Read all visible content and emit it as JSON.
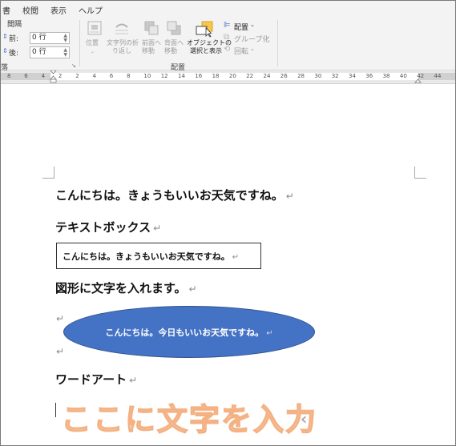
{
  "ribbon": {
    "tabs": [
      "書",
      "校閲",
      "表示",
      "ヘルプ"
    ],
    "spacing_label": "間隔",
    "before_label": "前:",
    "before_value": "0 行",
    "after_label": "後:",
    "after_value": "0 行",
    "paragraph_group_label": "落",
    "position_label": "位置",
    "wrap_text_label_1": "文字列の折",
    "wrap_text_label_2": "り返し",
    "bring_forward_label_1": "前面へ",
    "bring_forward_label_2": "移動",
    "send_backward_label_1": "背面へ",
    "send_backward_label_2": "移動",
    "selection_pane_label_1": "オブジェクトの",
    "selection_pane_label_2": "選択と表示",
    "align_label": "配置",
    "group_label": "グループ化",
    "rotate_label": "回転",
    "arrange_group_label": "配置"
  },
  "ruler": {
    "numbers": [
      "8",
      "6",
      "4",
      "2",
      "2",
      "4",
      "6",
      "8",
      "10",
      "12",
      "14",
      "16",
      "18",
      "20",
      "22",
      "24",
      "26",
      "28",
      "30",
      "32",
      "34",
      "36",
      "38",
      "40",
      "42",
      "44"
    ]
  },
  "document": {
    "line1": "こんにちは。きょうもいいお天気ですね。",
    "heading_textbox": "テキストボックス",
    "textbox_text": "こんにちは。きょうもいいお天気ですね。",
    "heading_shape": "図形に文字を入れます。",
    "shape_text": "こんにちは。今日もいいお天気ですね。",
    "heading_wordart": "ワードアート",
    "wordart_text": "ここに文字を入力",
    "paragraph_mark": "↵"
  },
  "colors": {
    "shape_fill": "#4472c4",
    "wordart_outline": "#f4b183",
    "selection_pane_icon": "#f8c64a"
  }
}
